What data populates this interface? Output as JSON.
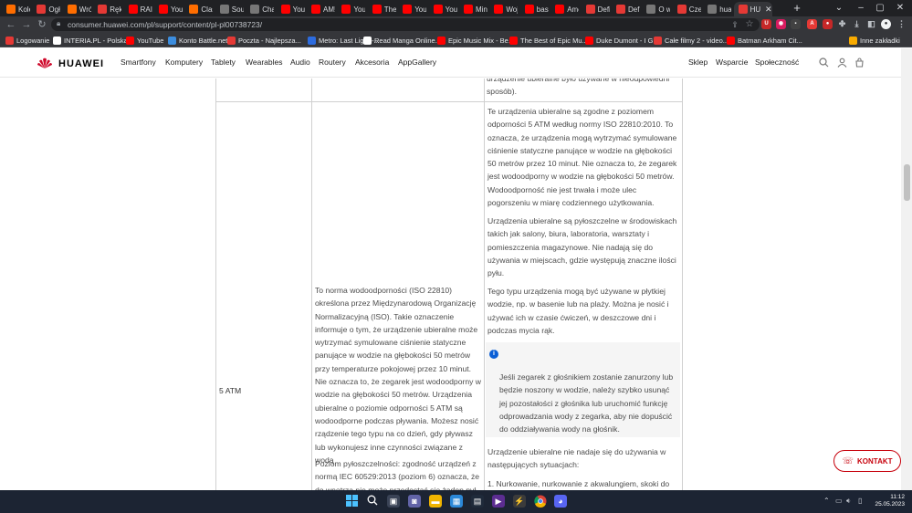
{
  "browser": {
    "tabs": [
      {
        "label": "Kole",
        "fav_color": "#ff6d00"
      },
      {
        "label": "Ogł",
        "fav_color": "#e53935"
      },
      {
        "label": "Wró",
        "fav_color": "#ff6d00"
      },
      {
        "label": "Ręka",
        "fav_color": "#e53935"
      },
      {
        "label": "RAIL",
        "fav_color": "#ff0000"
      },
      {
        "label": "You",
        "fav_color": "#ff0000"
      },
      {
        "label": "Clas",
        "fav_color": "#ff6d00"
      },
      {
        "label": "Sou",
        "fav_color": "#777777"
      },
      {
        "label": "Cha",
        "fav_color": "#777777"
      },
      {
        "label": "You",
        "fav_color": "#ff0000"
      },
      {
        "label": "AM!",
        "fav_color": "#ff0000"
      },
      {
        "label": "You",
        "fav_color": "#ff0000"
      },
      {
        "label": "The",
        "fav_color": "#ff0000"
      },
      {
        "label": "You",
        "fav_color": "#ff0000"
      },
      {
        "label": "You",
        "fav_color": "#ff0000"
      },
      {
        "label": "Min",
        "fav_color": "#ff0000"
      },
      {
        "label": "Woj",
        "fav_color": "#ff0000"
      },
      {
        "label": "bast",
        "fav_color": "#ff0000"
      },
      {
        "label": "Ame",
        "fav_color": "#ff0000"
      },
      {
        "label": "Defi",
        "fav_color": "#e53935"
      },
      {
        "label": "Defi",
        "fav_color": "#e53935"
      },
      {
        "label": "O w",
        "fav_color": "#777777"
      },
      {
        "label": "Czei",
        "fav_color": "#e53935"
      },
      {
        "label": "hua",
        "fav_color": "#777777"
      },
      {
        "label": "HUA",
        "fav_color": "#e53935"
      }
    ],
    "new_tab": "+",
    "url": "consumer.huawei.com/pl/support/content/pl-pl00738723/",
    "bookmarks": [
      {
        "label": "Logowanie",
        "color": "#e53935"
      },
      {
        "label": "INTERIA.PL - Polska...",
        "color": "#ffffff"
      },
      {
        "label": "YouTube",
        "color": "#ff0000"
      },
      {
        "label": "Konto Battle.net",
        "color": "#3c8dde"
      },
      {
        "label": "Poczta - Najlepsza...",
        "color": "#e53935"
      },
      {
        "label": "Metro: Last Light -...",
        "color": "#2d6cdf"
      },
      {
        "label": "Read Manga Online...",
        "color": "#ffffff"
      },
      {
        "label": "Epic Music Mix - Be...",
        "color": "#ff0000"
      },
      {
        "label": "The Best of Epic Mu...",
        "color": "#ff0000"
      },
      {
        "label": "Duke Dumont - I G...",
        "color": "#ff0000"
      },
      {
        "label": "Całe filmy 2 - video...",
        "color": "#e53935"
      },
      {
        "label": "Batman Arkham Cit...",
        "color": "#ff0000"
      }
    ],
    "other_bookmarks": "Inne zakładki"
  },
  "site": {
    "brand": "HUAWEI",
    "nav": [
      "Smartfony",
      "Komputery",
      "Tablety",
      "Wearables",
      "Audio",
      "Routery",
      "Akcesoria",
      "AppGallery"
    ],
    "right_nav": [
      "Sklep",
      "Wsparcie",
      "Społeczność"
    ]
  },
  "table": {
    "top_right_text": "urządzenie ubieralne było używane w nieodpowiedni sposób).",
    "row_label": "5 ATM",
    "middle_col": [
      "To norma wodoodporności (ISO 22810) określona przez Międzynarodową Organizację Normalizacyjną (ISO). Takie oznaczenie informuje o tym, że urządzenie ubieralne może wytrzymać symulowane ciśnienie statyczne panujące w wodzie na głębokości 50 metrów przy temperaturze pokojowej przez 10 minut. Nie oznacza to, że zegarek jest wodoodporny w wodzie na głębokości 50 metrów. Urządzenia ubieralne o poziomie odporności 5 ATM są wodoodporne podczas pływania. Możesz nosić rządzenie tego typu na co dzień, gdy pływasz lub wykonujesz inne czynności związane z wodą",
      "Poziom pyłoszczelności: zgodność urządzeń z normą IEC 60529:2013 (poziom 6) oznacza, że do wnętrza nie może przedostać się żaden pył"
    ],
    "right_col": [
      "Te urządzenia ubieralne są zgodne z poziomem odporności 5 ATM według normy ISO 22810:2010. To oznacza, że urządzenia mogą wytrzymać symulowane ciśnienie statyczne panujące w wodzie na głębokości 50 metrów przez 10 minut. Nie oznacza to, że zegarek jest wodoodporny w wodzie na głębokości 50 metrów. Wodoodporność nie jest trwała i może ulec pogorszeniu w miarę codziennego użytkowania.",
      "Urządzenia ubieralne są pyłoszczelne w środowiskach takich jak salony, biura, laboratoria, warsztaty i pomieszczenia magazynowe. Nie nadają się do używania w miejscach, gdzie występują znaczne ilości pyłu.",
      "Tego typu urządzenia mogą być używane w płytkiej wodzie, np. w basenie lub na plaży. Można je nosić i używać ich w czasie ćwiczeń, w deszczowe dni i podczas mycia rąk."
    ],
    "note": "Jeśli zegarek z głośnikiem zostanie zanurzony lub będzie noszony w wodzie, należy szybko usunąć jej pozostałości z głośnika lub uruchomić funkcję odprowadzania wody z zegarka, aby nie dopuścić do oddziaływania wody na głośnik.",
    "after_note": "Urządzenie ubieralne nie nadaje się do używania w następujących sytuacjach:",
    "list_item_1": "1. Nurkowanie, nurkowanie z akwalungiem, skoki do"
  },
  "contact_button": "KONTAKT",
  "taskbar": {
    "time": "11:12",
    "date": "25.05.2023"
  }
}
